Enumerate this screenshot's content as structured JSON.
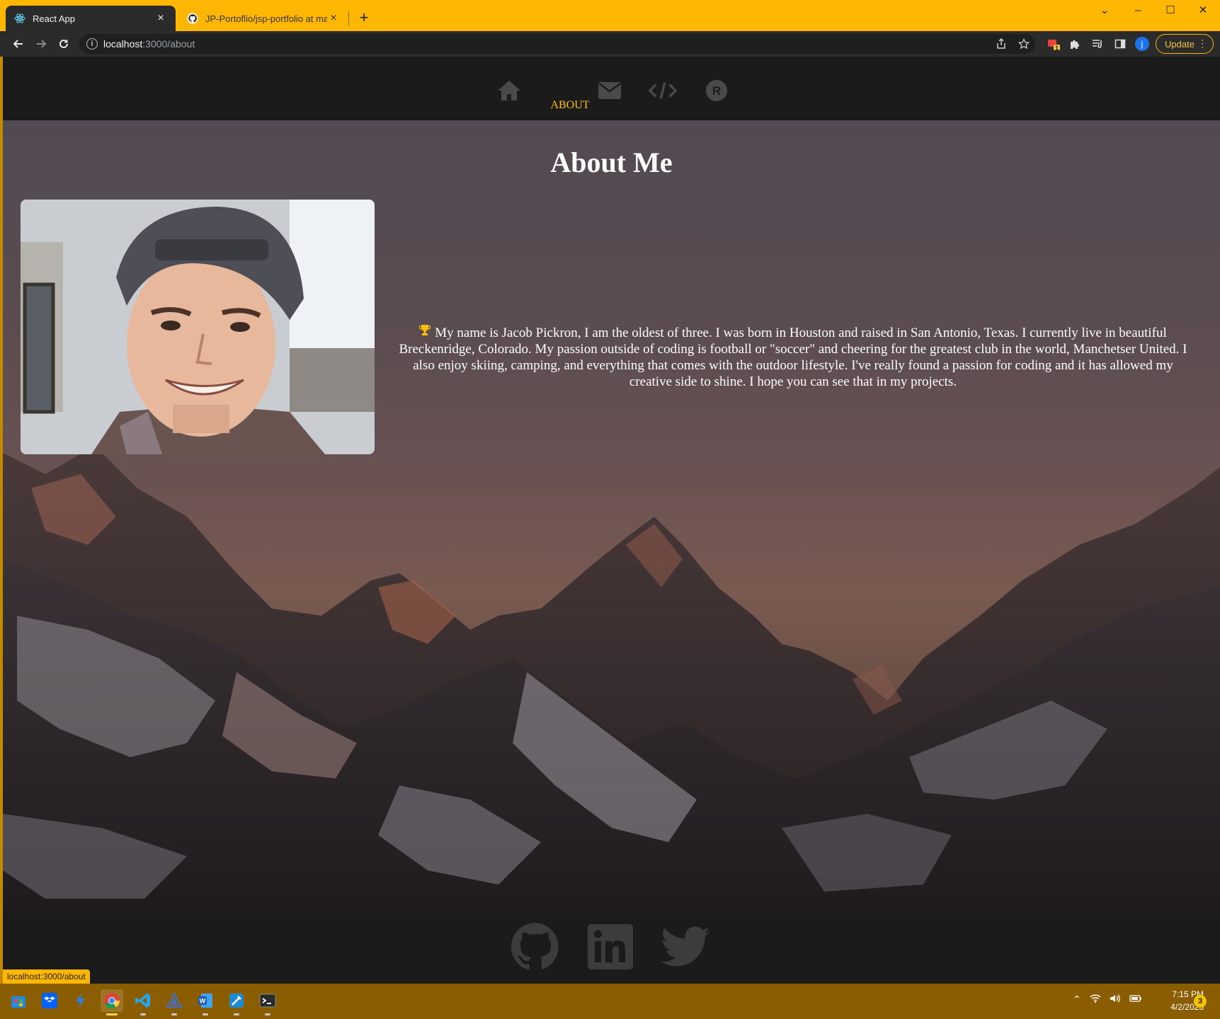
{
  "browser": {
    "tabs": [
      {
        "title": "React App",
        "active": true,
        "icon": "react-icon"
      },
      {
        "title": "JP-Portoflio/jsp-portfolio at main",
        "active": false,
        "icon": "github-icon"
      }
    ],
    "new_tab_label": "+",
    "window_controls": {
      "dropdown": "⌄",
      "minimize": "–",
      "maximize": "☐",
      "close": "✕"
    },
    "address": {
      "host": "localhost",
      "path": ":3000/about"
    },
    "profile_initial": "j",
    "update_label": "Update",
    "extension_badge": "1"
  },
  "site": {
    "nav": {
      "items": [
        "home",
        "about",
        "contact",
        "projects",
        "resume"
      ],
      "active_label": "ABOUT",
      "active_color": "#ffc107",
      "icon_color": "#4a4a4a"
    },
    "about": {
      "title": "About Me",
      "bio": "My name is Jacob Pickron, I am the oldest of three. I was born in Houston and raised in San Antonio, Texas. I currently live in beautiful Breckenridge, Colorado. My passion outside of coding is football or \"soccer\" and cheering for the greatest club in the world, Manchetser United. I also enjoy skiing, camping, and everything that comes with the outdoor lifestyle. I've really found a passion for coding and it has allowed my creative side to shine. I hope you can see that in my projects.",
      "bio_icon": "trophy-icon"
    },
    "footer": {
      "social": [
        "github-icon",
        "linkedin-icon",
        "twitter-icon"
      ]
    }
  },
  "status_bar": {
    "url": "localhost:3000/about"
  },
  "taskbar": {
    "apps": [
      "store",
      "dropbox",
      "azure-data-studio",
      "chrome",
      "vscode",
      "arduino",
      "word",
      "xcode-like",
      "terminal"
    ],
    "time": "7:15 PM",
    "date": "4/2/2023",
    "notifications": "3"
  }
}
